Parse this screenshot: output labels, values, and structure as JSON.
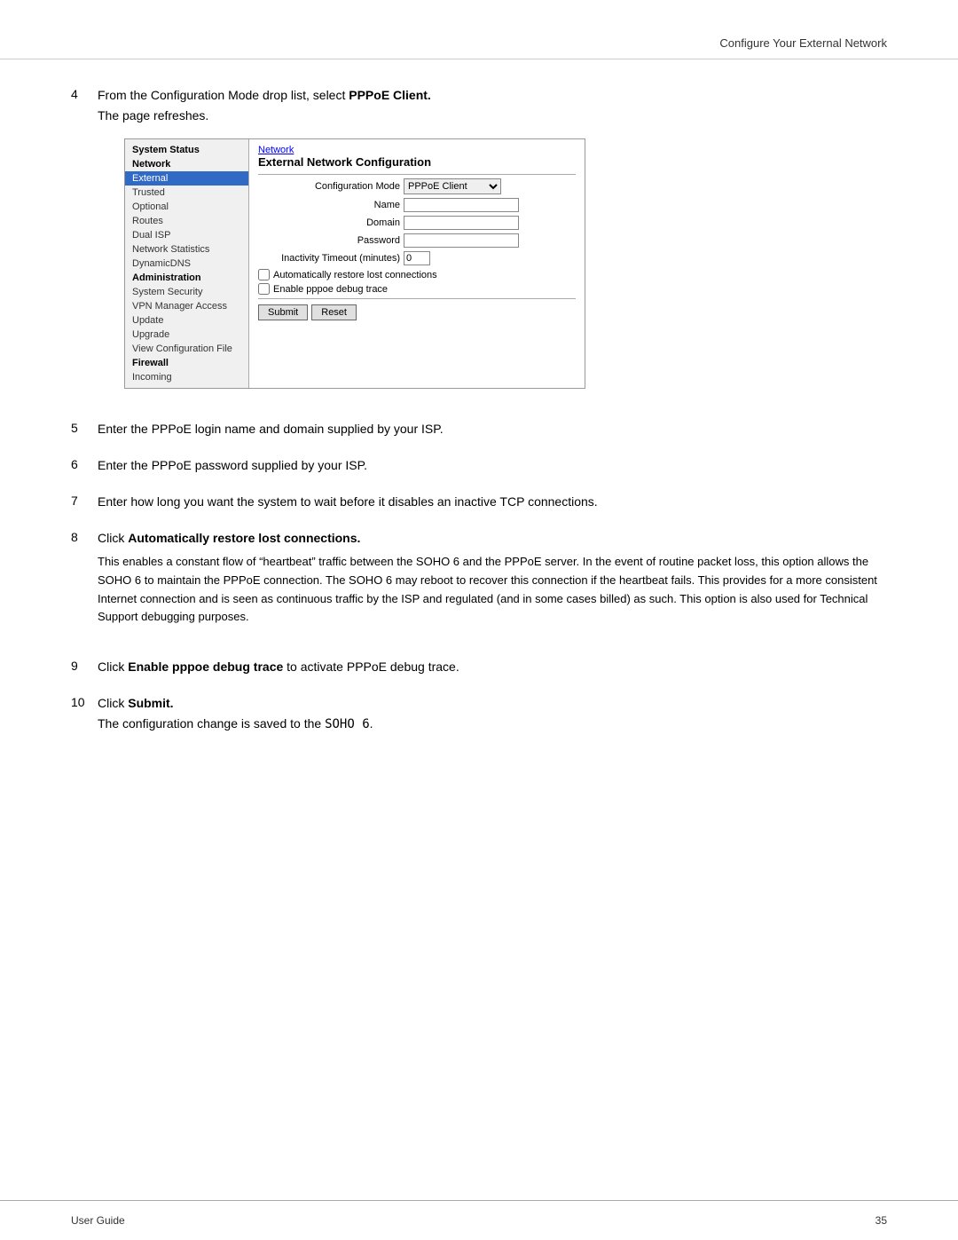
{
  "header": {
    "title": "Configure Your External Network"
  },
  "steps": [
    {
      "number": "4",
      "text_before": "From the Configuration Mode drop list, select ",
      "bold_text": "PPPoE Client.",
      "text_after": "",
      "sub_text": "The page refreshes."
    },
    {
      "number": "5",
      "text": "Enter the PPPoE login name and domain supplied by your ISP."
    },
    {
      "number": "6",
      "text": "Enter the PPPoE password supplied by your ISP."
    },
    {
      "number": "7",
      "text": "Enter how long you want the system to wait before it disables an inactive TCP connections."
    },
    {
      "number": "8",
      "text_before": "Click ",
      "bold_text": "Automatically restore lost connections.",
      "text_after": ""
    },
    {
      "number": "9",
      "text_before": "Click ",
      "bold_text": "Enable pppoe debug trace",
      "text_after": " to activate PPPoE debug trace."
    },
    {
      "number": "10",
      "text_before": "Click ",
      "bold_text": "Submit.",
      "text_after": ""
    }
  ],
  "step8_para": "This enables a constant flow of “heartbeat” traffic between the SOHO 6 and the PPPoE server.  In the event of routine packet loss, this option allows the SOHO 6 to maintain the PPPoE connection.  The SOHO 6 may reboot to recover this connection if the heartbeat fails.  This provides for a more consistent Internet connection and is seen as continuous traffic by the ISP and regulated (and in some cases billed) as such. This option is also used for Technical Support debugging purposes.",
  "step10_sub": "The configuration change is saved to the SOHO 6.",
  "screenshot": {
    "sidebar": {
      "items": [
        {
          "label": "System Status",
          "type": "bold"
        },
        {
          "label": "Network",
          "type": "bold"
        },
        {
          "label": "External",
          "type": "selected"
        },
        {
          "label": "Trusted",
          "type": "normal"
        },
        {
          "label": "Optional",
          "type": "normal"
        },
        {
          "label": "Routes",
          "type": "normal"
        },
        {
          "label": "Dual ISP",
          "type": "normal"
        },
        {
          "label": "Network Statistics",
          "type": "normal"
        },
        {
          "label": "DynamicDNS",
          "type": "normal"
        },
        {
          "label": "Administration",
          "type": "bold"
        },
        {
          "label": "System Security",
          "type": "normal"
        },
        {
          "label": "VPN Manager Access",
          "type": "normal"
        },
        {
          "label": "Update",
          "type": "normal"
        },
        {
          "label": "Upgrade",
          "type": "normal"
        },
        {
          "label": "View Configuration File",
          "type": "normal"
        },
        {
          "label": "Firewall",
          "type": "bold"
        },
        {
          "label": "Incoming",
          "type": "normal"
        }
      ]
    },
    "main": {
      "breadcrumb": "Network",
      "title": "External Network Configuration",
      "config_mode_label": "Configuration Mode",
      "config_mode_value": "PPPoE Client",
      "name_label": "Name",
      "domain_label": "Domain",
      "password_label": "Password",
      "inactivity_label": "Inactivity Timeout (minutes)",
      "inactivity_value": "0",
      "checkbox1": "Automatically restore lost connections",
      "checkbox2": "Enable pppoe debug trace",
      "submit_label": "Submit",
      "reset_label": "Reset"
    }
  },
  "footer": {
    "left": "User Guide",
    "right": "35"
  }
}
